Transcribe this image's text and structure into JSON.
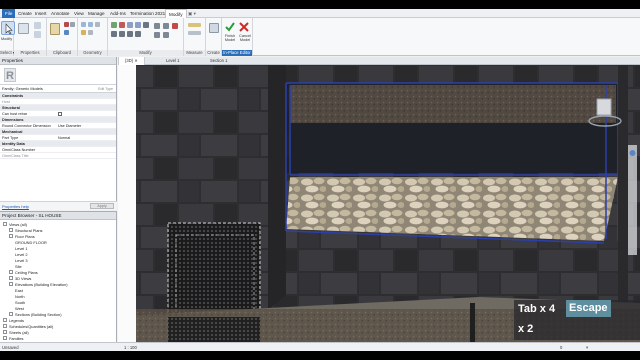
{
  "ribbon": {
    "tabs": [
      "File",
      "Create",
      "Insert",
      "Annotate",
      "View",
      "Manage",
      "Add-Ins",
      "Termination 2021",
      "Modify"
    ],
    "groups": {
      "select": "Select ▾",
      "properties": "Properties",
      "clipboard": "Clipboard",
      "geometry": "Geometry",
      "modify": "Modify",
      "measure": "Measure",
      "create": "Create",
      "inplace": "In-Place Editor"
    },
    "buttons": {
      "modify": "Modify",
      "finish": "Finish Model",
      "cancel": "Cancel Model"
    }
  },
  "properties": {
    "title": "Properties",
    "type_name": "Family: Generic Models",
    "edit_type": "Edit Type",
    "rows": [
      {
        "k": "Constraints",
        "v": "",
        "cat": true
      },
      {
        "k": "Host",
        "v": "",
        "gray": true
      },
      {
        "k": "Structural",
        "v": "",
        "cat": true
      },
      {
        "k": "Can host rebar",
        "v": "",
        "chk": true
      },
      {
        "k": "Dimensions",
        "v": "",
        "cat": true
      },
      {
        "k": "Round Connector Dimension",
        "v": "Use Diameter"
      },
      {
        "k": "Mechanical",
        "v": "",
        "cat": true
      },
      {
        "k": "Part Type",
        "v": "Normal"
      },
      {
        "k": "Identity Data",
        "v": "",
        "cat": true
      },
      {
        "k": "OmniClass Number",
        "v": ""
      },
      {
        "k": "OmniClass Title",
        "v": "",
        "gray": true
      }
    ],
    "help": "Properties help",
    "apply": "Apply"
  },
  "browser": {
    "title": "Project Browser - SL HOUSE",
    "items": [
      {
        "t": "Views (all)",
        "lvl": 0,
        "tog": "-"
      },
      {
        "t": "Structural Plans",
        "lvl": 1,
        "tog": "+"
      },
      {
        "t": "Floor Plans",
        "lvl": 1,
        "tog": "-"
      },
      {
        "t": "GROUND FLOOR",
        "lvl": 2
      },
      {
        "t": "Level 1",
        "lvl": 2
      },
      {
        "t": "Level 2",
        "lvl": 2
      },
      {
        "t": "Level 3",
        "lvl": 2
      },
      {
        "t": "Site",
        "lvl": 2
      },
      {
        "t": "Ceiling Plans",
        "lvl": 1,
        "tog": "+"
      },
      {
        "t": "3D Views",
        "lvl": 1,
        "tog": "+"
      },
      {
        "t": "Elevations (Building Elevation)",
        "lvl": 1,
        "tog": "-"
      },
      {
        "t": "East",
        "lvl": 2
      },
      {
        "t": "North",
        "lvl": 2
      },
      {
        "t": "South",
        "lvl": 2
      },
      {
        "t": "West",
        "lvl": 2
      },
      {
        "t": "Sections (Building Section)",
        "lvl": 1,
        "tog": "+"
      },
      {
        "t": "Legends",
        "lvl": 0,
        "tog": "+"
      },
      {
        "t": "Schedules/Quantities (all)",
        "lvl": 0,
        "tog": "+"
      },
      {
        "t": "Sheets (all)",
        "lvl": 0,
        "tog": "+"
      },
      {
        "t": "Families",
        "lvl": 0,
        "tog": "+"
      },
      {
        "t": "Groups",
        "lvl": 0,
        "tog": "+"
      }
    ]
  },
  "viewtabs": [
    "{3D}",
    "Level 1",
    "Section 1"
  ],
  "status": {
    "left": "Unsaved",
    "scale": "1 : 100",
    "right": "0"
  },
  "overlay": {
    "line1": "Tab x 4",
    "key": "Escape",
    "line2": "x 2"
  },
  "colors": {
    "accent": "#2a6ebb",
    "key": "#5f8e9f",
    "selection": "#2d3fa8"
  }
}
